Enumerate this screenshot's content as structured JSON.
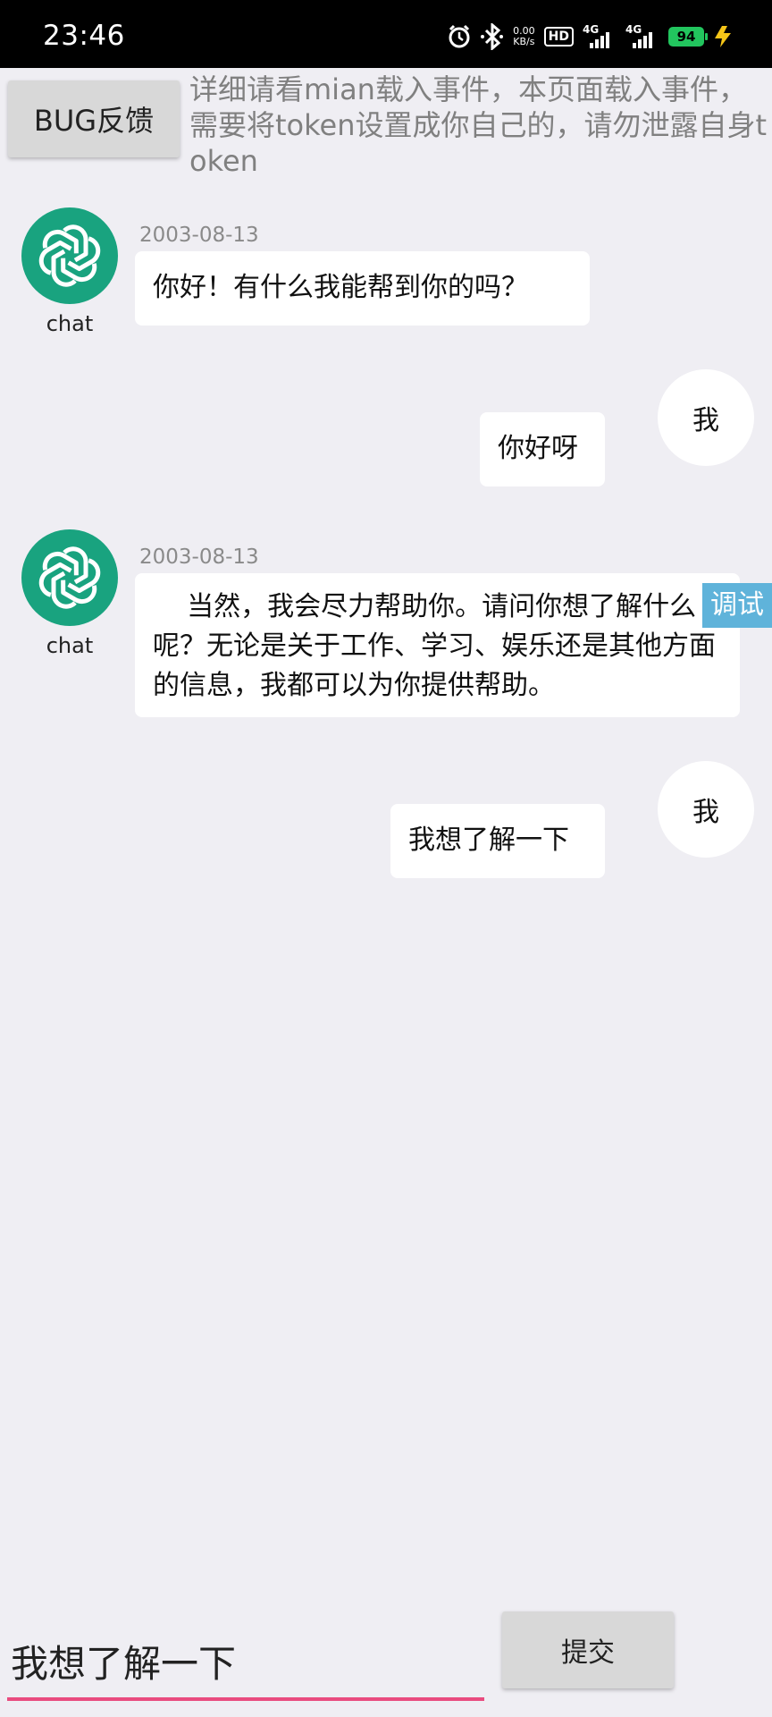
{
  "status_bar": {
    "time": "23:46",
    "net_speed_value": "0.00",
    "net_speed_unit": "KB/s",
    "hd_label": "HD",
    "signal1_label": "4G",
    "signal2_label": "4G",
    "battery": "94",
    "icons": [
      "alarm-icon",
      "bluetooth-icon",
      "hd-icon",
      "signal-4g-icon",
      "signal-4g-icon",
      "battery-icon",
      "charging-icon"
    ]
  },
  "top": {
    "bug_button_label": "BUG反馈",
    "notice_text": "详细请看mian载入事件，本页面载入事件，需要将token设置成你自己的，请勿泄露自身token"
  },
  "messages": [
    {
      "sender": "chat",
      "timestamp": "2003-08-13",
      "text": "你好！有什么我能帮到你的吗？"
    },
    {
      "sender": "我",
      "text": "你好呀"
    },
    {
      "sender": "chat",
      "timestamp": "2003-08-13",
      "text": "    当然，我会尽力帮助你。请问你想了解什么呢？无论是关于工作、学习、娱乐还是其他方面的信息，我都可以为你提供帮助。"
    },
    {
      "sender": "我",
      "text": "我想了解一下"
    }
  ],
  "debug_label": "调试",
  "input": {
    "value": "我想了解一下",
    "submit_label": "提交"
  },
  "colors": {
    "accent": "#e94b7f",
    "gpt_avatar": "#19a37f",
    "debug": "#5fb3da",
    "background": "#efeef3"
  }
}
